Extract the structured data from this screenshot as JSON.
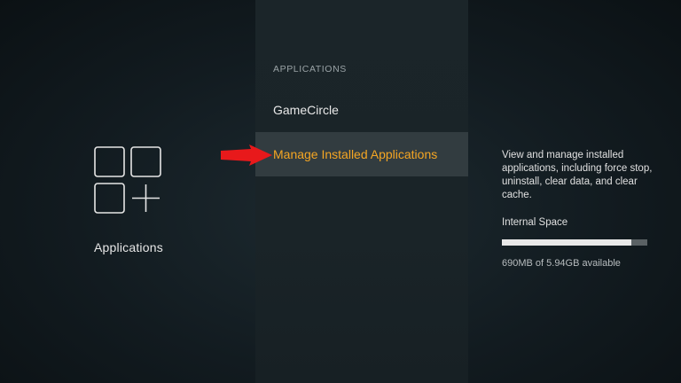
{
  "left": {
    "icon": "applications-grid-plus-icon",
    "label": "Applications"
  },
  "menu": {
    "header": "APPLICATIONS",
    "items": [
      {
        "label": "GameCircle",
        "selected": false
      },
      {
        "label": "Manage Installed Applications",
        "selected": true
      }
    ]
  },
  "details": {
    "description": "View and manage installed applications, including force stop, uninstall, clear data, and clear cache.",
    "storage_title": "Internal Space",
    "storage_text": "690MB of 5.94GB available",
    "storage_used_fraction": 0.89
  },
  "colors": {
    "accent": "#f5a623",
    "arrow": "#e8191b",
    "selected_bg": "#323c40"
  }
}
